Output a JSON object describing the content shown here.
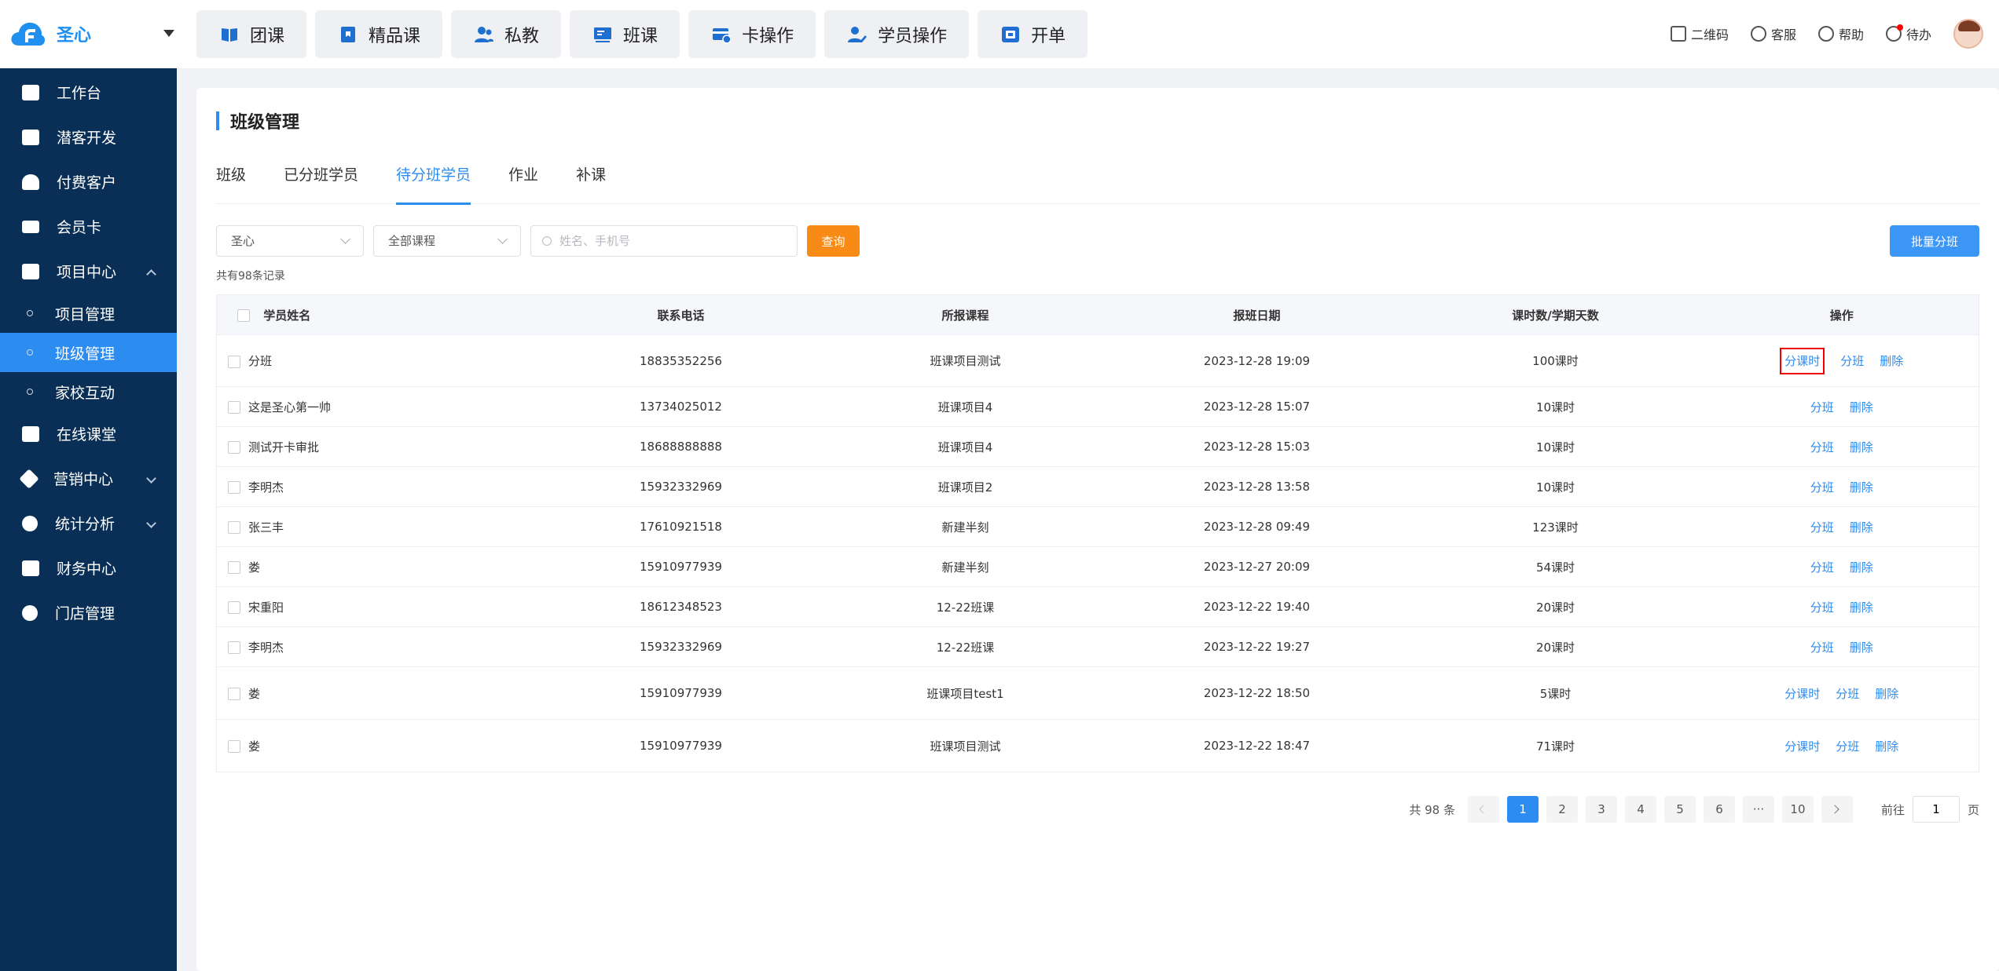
{
  "header": {
    "org_name": "圣心",
    "nav": [
      {
        "label": "团课",
        "icon": "book-icon"
      },
      {
        "label": "精品课",
        "icon": "bookmark-book-icon"
      },
      {
        "label": "私教",
        "icon": "users-icon"
      },
      {
        "label": "班课",
        "icon": "board-icon"
      },
      {
        "label": "卡操作",
        "icon": "card-edit-icon"
      },
      {
        "label": "学员操作",
        "icon": "user-edit-icon"
      },
      {
        "label": "开单",
        "icon": "order-icon"
      }
    ],
    "right": {
      "qrcode": "二维码",
      "service": "客服",
      "help": "帮助",
      "todo": "待办"
    }
  },
  "sidebar": {
    "items": [
      {
        "label": "工作台",
        "icon": "image-icon"
      },
      {
        "label": "潜客开发",
        "icon": "id-card-icon"
      },
      {
        "label": "付费客户",
        "icon": "user-group-icon"
      },
      {
        "label": "会员卡",
        "icon": "credit-card-icon"
      },
      {
        "label": "项目中心",
        "icon": "project-icon",
        "expanded": true
      },
      {
        "label": "在线课堂",
        "icon": "play-icon"
      },
      {
        "label": "营销中心",
        "icon": "tag-icon"
      },
      {
        "label": "统计分析",
        "icon": "pie-chart-icon"
      },
      {
        "label": "财务中心",
        "icon": "wallet-icon"
      },
      {
        "label": "门店管理",
        "icon": "store-icon"
      }
    ],
    "subitems": [
      "项目管理",
      "班级管理",
      "家校互动"
    ],
    "active_sub": "班级管理"
  },
  "page": {
    "title": "班级管理",
    "tabs": [
      "班级",
      "已分班学员",
      "待分班学员",
      "作业",
      "补课"
    ],
    "active_tab": "待分班学员",
    "filters": {
      "store": "圣心",
      "course": "全部课程",
      "search_placeholder": "姓名、手机号",
      "query_label": "查询",
      "batch_label": "批量分班"
    },
    "total_records": "共有98条记录"
  },
  "table": {
    "headers": [
      "学员姓名",
      "联系电话",
      "所报课程",
      "报班日期",
      "课时数/学期天数",
      "操作"
    ],
    "rows": [
      {
        "name": "分班",
        "phone": "18835352256",
        "course": "班课项目测试",
        "date": "2023-12-28 19:09",
        "hours": "100课时",
        "ops": [
          "分课时",
          "分班",
          "删除"
        ],
        "highlight": true
      },
      {
        "name": "这是圣心第一帅",
        "phone": "13734025012",
        "course": "班课项目4",
        "date": "2023-12-28 15:07",
        "hours": "10课时",
        "ops": [
          "分班",
          "删除"
        ]
      },
      {
        "name": "测试开卡审批",
        "phone": "18688888888",
        "course": "班课项目4",
        "date": "2023-12-28 15:03",
        "hours": "10课时",
        "ops": [
          "分班",
          "删除"
        ]
      },
      {
        "name": "李明杰",
        "phone": "15932332969",
        "course": "班课项目2",
        "date": "2023-12-28 13:58",
        "hours": "10课时",
        "ops": [
          "分班",
          "删除"
        ]
      },
      {
        "name": "张三丰",
        "phone": "17610921518",
        "course": "新建半刻",
        "date": "2023-12-28 09:49",
        "hours": "123课时",
        "ops": [
          "分班",
          "删除"
        ]
      },
      {
        "name": "娄",
        "phone": "15910977939",
        "course": "新建半刻",
        "date": "2023-12-27 20:09",
        "hours": "54课时",
        "ops": [
          "分班",
          "删除"
        ]
      },
      {
        "name": "宋重阳",
        "phone": "18612348523",
        "course": "12-22班课",
        "date": "2023-12-22 19:40",
        "hours": "20课时",
        "ops": [
          "分班",
          "删除"
        ]
      },
      {
        "name": "李明杰",
        "phone": "15932332969",
        "course": "12-22班课",
        "date": "2023-12-22 19:27",
        "hours": "20课时",
        "ops": [
          "分班",
          "删除"
        ]
      },
      {
        "name": "娄",
        "phone": "15910977939",
        "course": "班课项目test1",
        "date": "2023-12-22 18:50",
        "hours": "5课时",
        "ops": [
          "分课时",
          "分班",
          "删除"
        ]
      },
      {
        "name": "娄",
        "phone": "15910977939",
        "course": "班课项目测试",
        "date": "2023-12-22 18:47",
        "hours": "71课时",
        "ops": [
          "分课时",
          "分班",
          "删除"
        ]
      }
    ]
  },
  "pagination": {
    "total": "共 98 条",
    "pages": [
      "1",
      "2",
      "3",
      "4",
      "5",
      "6",
      "···",
      "10"
    ],
    "current": "1",
    "goto_label": "前往",
    "goto_value": "1",
    "page_suffix": "页"
  },
  "colors": {
    "primary": "#2d8cf0",
    "query": "#f78b16",
    "sidebar": "#0a2f56",
    "highlight_border": "#e00000"
  }
}
